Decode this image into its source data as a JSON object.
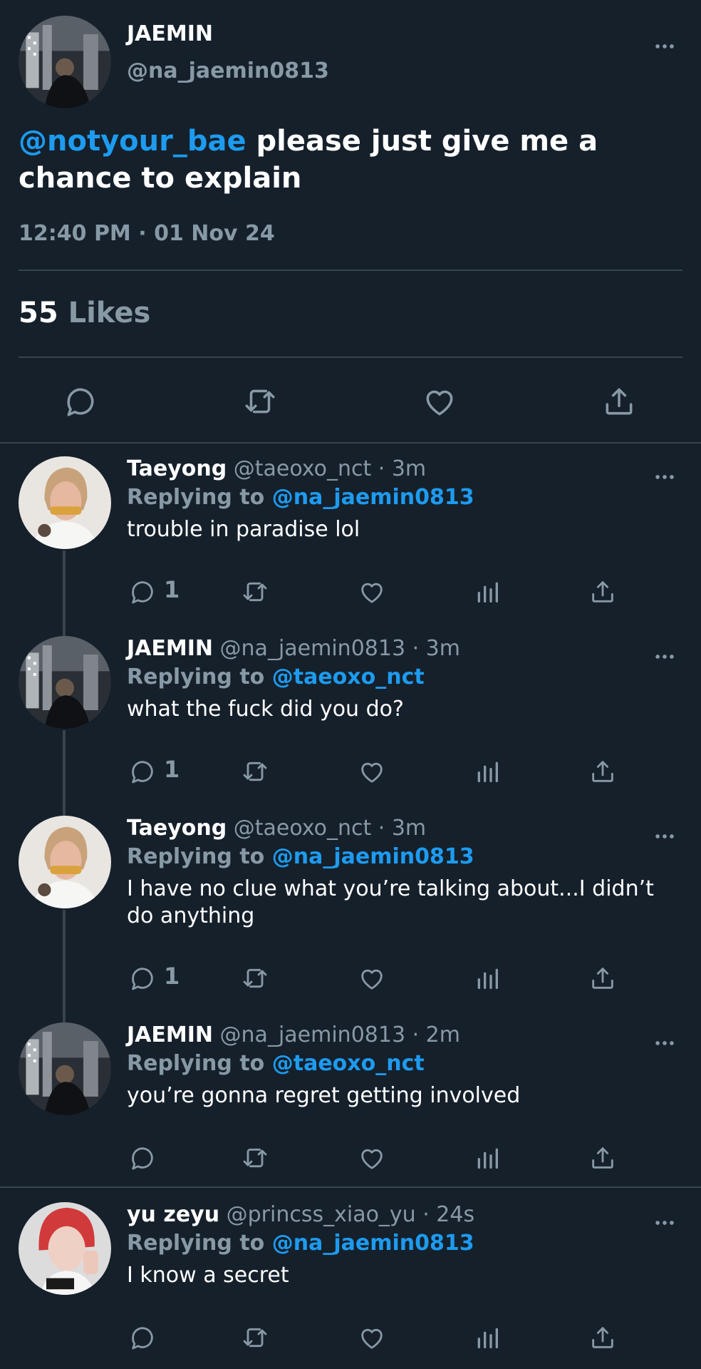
{
  "colors": {
    "background": "#15202b",
    "mention": "#1d9bf0",
    "muted": "#8899a6",
    "divider": "#38444d"
  },
  "main": {
    "name": "JAEMIN",
    "handle": "@na_jaemin0813",
    "mention": "@notyour_bae",
    "text": "please just give me a chance to explain",
    "time": "12:40 PM · 01 Nov 24",
    "likes_count": "55",
    "likes_label": "Likes",
    "avatar_icon": "avatar-jaemin",
    "action_icons": [
      "reply-icon",
      "retweet-icon",
      "heart-icon",
      "share-icon"
    ]
  },
  "replies": [
    {
      "name": "Taeyong",
      "meta": "@taeoxo_nct · 3m",
      "replying_label": "Replying to",
      "replying_to": "@na_jaemin0813",
      "text": "trouble in paradise lol",
      "reply_count": "1",
      "avatar_icon": "avatar-taeyong"
    },
    {
      "name": "JAEMIN",
      "meta": "@na_jaemin0813 · 3m",
      "replying_label": "Replying to",
      "replying_to": "@taeoxo_nct",
      "text": "what the fuck did you do?",
      "reply_count": "1",
      "avatar_icon": "avatar-jaemin"
    },
    {
      "name": "Taeyong",
      "meta": "@taeoxo_nct · 3m",
      "replying_label": "Replying to",
      "replying_to": "@na_jaemin0813",
      "text": "I have no clue what you’re talking about...I didn’t do anything",
      "reply_count": "1",
      "avatar_icon": "avatar-taeyong"
    },
    {
      "name": "JAEMIN",
      "meta": "@na_jaemin0813 · 2m",
      "replying_label": "Replying to",
      "replying_to": "@taeoxo_nct",
      "text": "you’re gonna regret getting involved",
      "reply_count": "",
      "avatar_icon": "avatar-jaemin"
    },
    {
      "name": "yu zeyu",
      "meta": "@princss_xiao_yu · 24s",
      "replying_label": "Replying to",
      "replying_to": "@na_jaemin0813",
      "text": "I know a secret",
      "reply_count": "",
      "avatar_icon": "avatar-yuzeyu"
    }
  ]
}
